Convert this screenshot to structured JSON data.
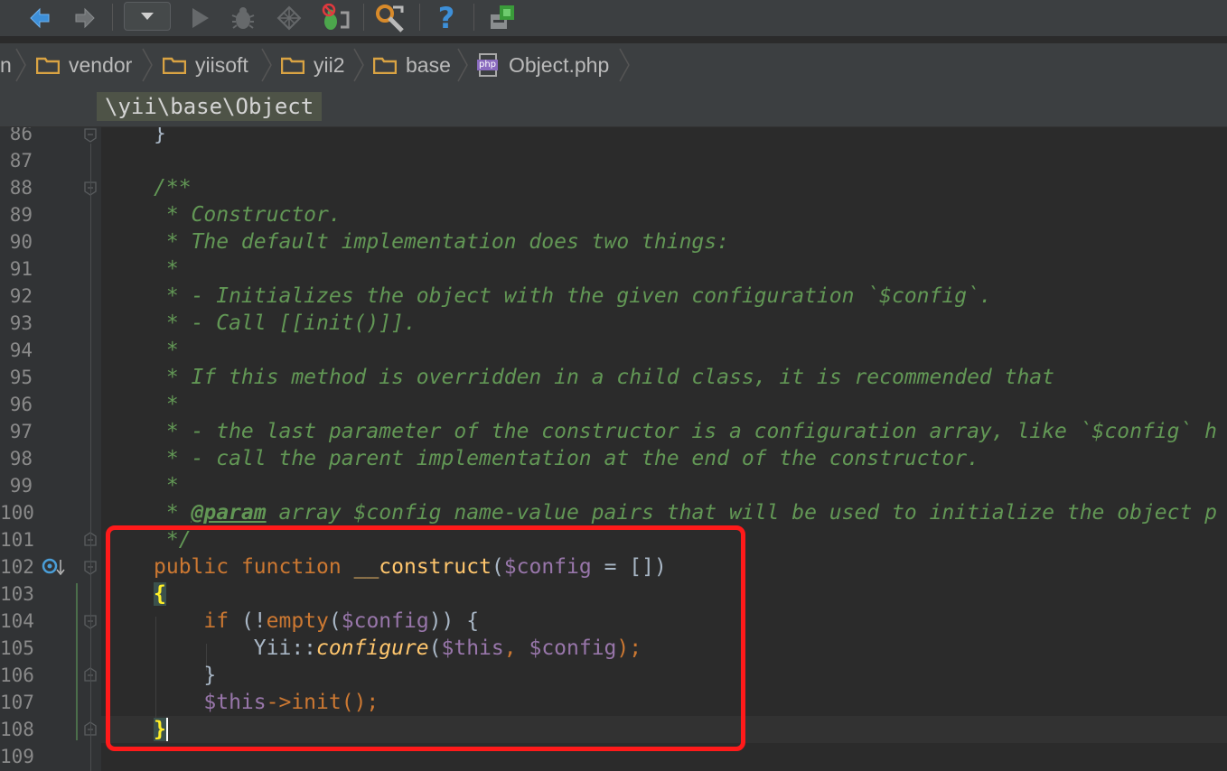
{
  "toolbar": {
    "buttons": [
      {
        "name": "back-button",
        "icon": "arrow-left-icon"
      },
      {
        "name": "forward-button",
        "icon": "arrow-right-icon"
      },
      {
        "name": "run-config-dropdown",
        "icon": "chevron-down-icon"
      },
      {
        "name": "run-button",
        "icon": "play-icon"
      },
      {
        "name": "debug-button",
        "icon": "bug-icon"
      },
      {
        "name": "coverage-button",
        "icon": "coverage-icon"
      },
      {
        "name": "stop-debug-button",
        "icon": "stop-bug-icon"
      },
      {
        "name": "settings-button",
        "icon": "wrench-icon"
      },
      {
        "name": "help-button",
        "icon": "question-icon"
      },
      {
        "name": "sdk-button",
        "icon": "sdk-icon"
      }
    ],
    "help_glyph": "?"
  },
  "breadcrumb": {
    "items": [
      {
        "label": "n",
        "type": "folder"
      },
      {
        "label": "vendor",
        "type": "folder"
      },
      {
        "label": "yiisoft",
        "type": "folder"
      },
      {
        "label": "yii2",
        "type": "folder"
      },
      {
        "label": "base",
        "type": "folder"
      },
      {
        "label": "Object.php",
        "type": "php-file"
      }
    ],
    "php_badge": "php"
  },
  "namespace": "\\yii\\base\\Object",
  "editor": {
    "line_numbers": [
      "86",
      "87",
      "88",
      "89",
      "90",
      "91",
      "92",
      "93",
      "94",
      "95",
      "96",
      "97",
      "98",
      "99",
      "100",
      "101",
      "102",
      "103",
      "104",
      "105",
      "106",
      "107",
      "108",
      "109"
    ],
    "lines": {
      "l86": "}",
      "l88": "/**",
      "l89": " * Constructor.",
      "l90": " * The default implementation does two things:",
      "l91": " *",
      "l92": " * - Initializes the object with the given configuration `$config`.",
      "l93": " * - Call [[init()]].",
      "l94": " *",
      "l95": " * If this method is overridden in a child class, it is recommended that",
      "l96": " *",
      "l97": " * - the last parameter of the constructor is a configuration array, like `$config` h",
      "l98": " * - call the parent implementation at the end of the constructor.",
      "l99": " *",
      "l100_pre": " * ",
      "l100_tag": "@param",
      "l100_post": " array $config name-value pairs that will be used to initialize the object p",
      "l101": " */",
      "l102_kw1": "public",
      "l102_kw2": "function",
      "l102_fn": "__construct",
      "l102_open": "(",
      "l102_var": "$config",
      "l102_rest": " = [])",
      "l103": "{",
      "l104_kw": "if",
      "l104_a": " (!",
      "l104_fn": "empty",
      "l104_b": "(",
      "l104_var": "$config",
      "l104_c": ")) {",
      "l105_cls": "Yii::",
      "l105_fn": "configure",
      "l105_a": "(",
      "l105_v1": "$this",
      "l105_b": ", ",
      "l105_v2": "$config",
      "l105_c": ");",
      "l106": "}",
      "l107_var": "$this",
      "l107_rest": "->init();",
      "l108": "}"
    }
  },
  "colors": {
    "comment": "#629755",
    "keyword": "#cc7832",
    "variable": "#9876aa",
    "function": "#ffc66d",
    "brace_match": "#ffef28",
    "highlight_box": "#ff1a1a"
  }
}
